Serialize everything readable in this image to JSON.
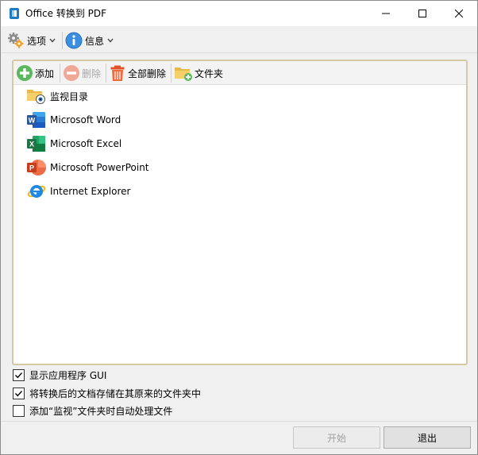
{
  "window": {
    "title": "Office 转换到 PDF"
  },
  "menu": {
    "options_label": "选项",
    "info_label": "信息"
  },
  "toolbar": {
    "add_label": "添加",
    "delete_label": "删除",
    "delete_all_label": "全部删除",
    "folder_label": "文件夹"
  },
  "list": {
    "items": [
      {
        "label": "监视目录",
        "icon": "watch-folder-icon"
      },
      {
        "label": "Microsoft Word",
        "icon": "word-icon"
      },
      {
        "label": "Microsoft Excel",
        "icon": "excel-icon"
      },
      {
        "label": "Microsoft PowerPoint",
        "icon": "powerpoint-icon"
      },
      {
        "label": "Internet Explorer",
        "icon": "ie-icon"
      }
    ]
  },
  "options": {
    "show_gui": {
      "label": "显示应用程序 GUI",
      "checked": true
    },
    "save_original": {
      "label": "将转换后的文档存储在其原来的文件夹中",
      "checked": true
    },
    "auto_process": {
      "label": "添加“监视”文件夹时自动处理文件",
      "checked": false
    }
  },
  "buttons": {
    "start_label": "开始",
    "exit_label": "退出"
  },
  "colors": {
    "panel_border": "#d6c9a2",
    "word": "#2b579a",
    "excel": "#217346",
    "powerpoint": "#d24726",
    "add_green": "#5cb85c",
    "delete_red": "#e8806a",
    "info_blue": "#3b8ee0"
  }
}
